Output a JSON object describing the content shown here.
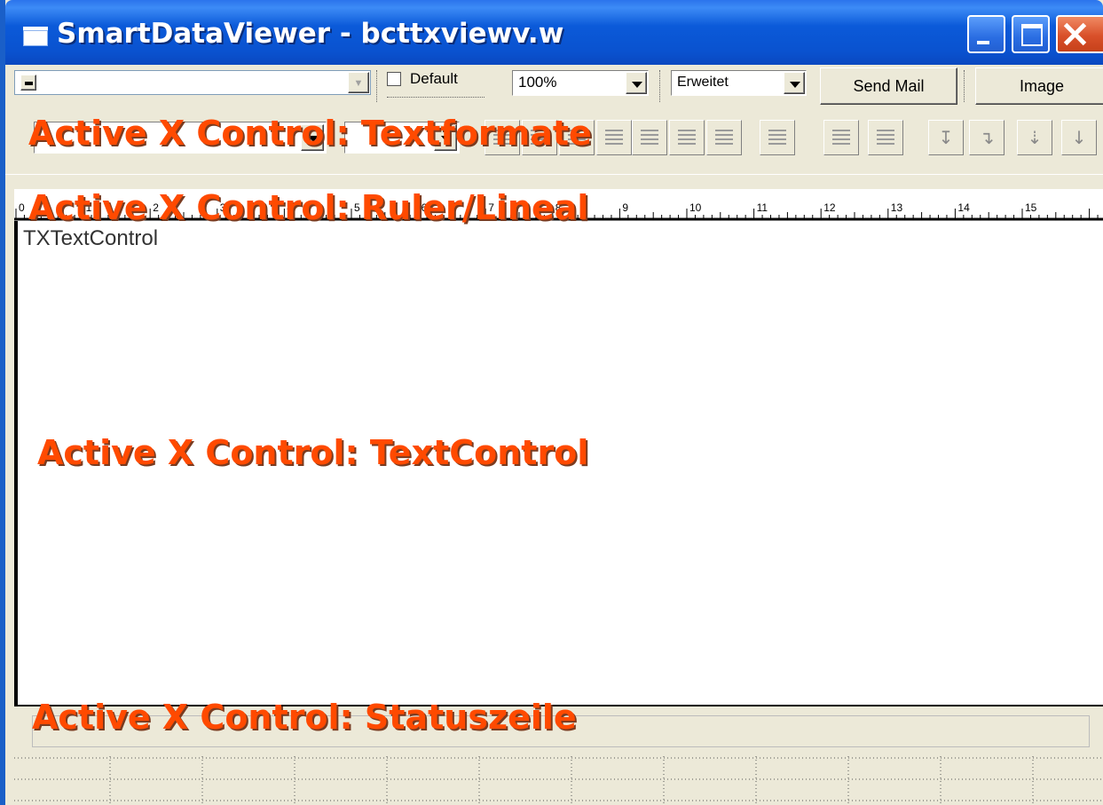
{
  "window": {
    "title": "SmartDataViewer - bcttxviewv.w"
  },
  "toolbar": {
    "default_label": "Default",
    "zoom_value": "100%",
    "mode_value": "Erweitet",
    "send_mail_label": "Send Mail",
    "image_label": "Image"
  },
  "ruler": {
    "ticks": [
      "0",
      "1",
      "2",
      "3",
      "4",
      "5",
      "6",
      "7",
      "8",
      "9",
      "10",
      "11",
      "12",
      "13",
      "14",
      "15"
    ]
  },
  "textcontrol": {
    "content": "TXTextControl"
  },
  "annotations": {
    "textformate": "Active X Control: Textformate",
    "ruler": "Active X Control: Ruler/Lineal",
    "textcontrol": "Active X Control: TextControl",
    "status": "Active X Control: Statuszeile"
  },
  "colors": {
    "annotation": "#ff4a00",
    "titlebar": "#0a52cf",
    "close_button": "#d9502a"
  },
  "icons": {
    "format_buttons": [
      "align-left-icon",
      "align-center-icon",
      "align-right-icon",
      "align-justify-icon",
      "align-left-2-icon",
      "align-center-2-icon",
      "align-right-2-icon",
      "justify-icon",
      "numbered-list-icon",
      "bullet-list-icon",
      "indent-first-icon",
      "indent-left-icon",
      "indent-hanging-icon",
      "indent-down-icon"
    ]
  }
}
